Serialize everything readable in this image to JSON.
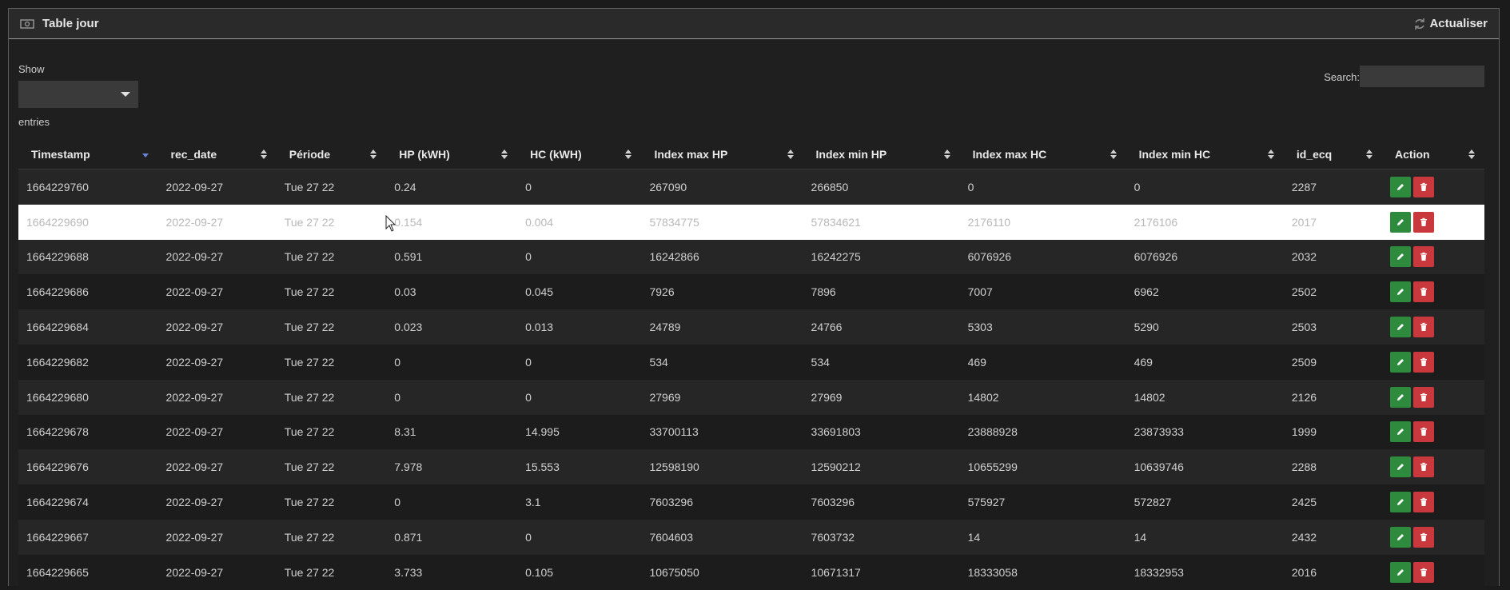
{
  "panel": {
    "title": "Table jour",
    "refresh_label": "Actualiser"
  },
  "controls": {
    "show_label": "Show",
    "entries_label": "entries",
    "search_label": "Search:",
    "search_value": ""
  },
  "columns": [
    "Timestamp",
    "rec_date",
    "Période",
    "HP (kWH)",
    "HC (kWH)",
    "Index max HP",
    "Index min HP",
    "Index max HC",
    "Index min HC",
    "id_ecq",
    "Action"
  ],
  "sorted_column": "Timestamp",
  "rows": [
    [
      "1664229760",
      "2022-09-27",
      "Tue 27 22",
      "0.24",
      "0",
      "267090",
      "266850",
      "0",
      "0",
      "2287"
    ],
    [
      "1664229690",
      "2022-09-27",
      "Tue 27 22",
      "0.154",
      "0.004",
      "57834775",
      "57834621",
      "2176110",
      "2176106",
      "2017"
    ],
    [
      "1664229688",
      "2022-09-27",
      "Tue 27 22",
      "0.591",
      "0",
      "16242866",
      "16242275",
      "6076926",
      "6076926",
      "2032"
    ],
    [
      "1664229686",
      "2022-09-27",
      "Tue 27 22",
      "0.03",
      "0.045",
      "7926",
      "7896",
      "7007",
      "6962",
      "2502"
    ],
    [
      "1664229684",
      "2022-09-27",
      "Tue 27 22",
      "0.023",
      "0.013",
      "24789",
      "24766",
      "5303",
      "5290",
      "2503"
    ],
    [
      "1664229682",
      "2022-09-27",
      "Tue 27 22",
      "0",
      "0",
      "534",
      "534",
      "469",
      "469",
      "2509"
    ],
    [
      "1664229680",
      "2022-09-27",
      "Tue 27 22",
      "0",
      "0",
      "27969",
      "27969",
      "14802",
      "14802",
      "2126"
    ],
    [
      "1664229678",
      "2022-09-27",
      "Tue 27 22",
      "8.31",
      "14.995",
      "33700113",
      "33691803",
      "23888928",
      "23873933",
      "1999"
    ],
    [
      "1664229676",
      "2022-09-27",
      "Tue 27 22",
      "7.978",
      "15.553",
      "12598190",
      "12590212",
      "10655299",
      "10639746",
      "2288"
    ],
    [
      "1664229674",
      "2022-09-27",
      "Tue 27 22",
      "0",
      "3.1",
      "7603296",
      "7603296",
      "575927",
      "572827",
      "2425"
    ],
    [
      "1664229667",
      "2022-09-27",
      "Tue 27 22",
      "0.871",
      "0",
      "7604603",
      "7603732",
      "14",
      "14",
      "2432"
    ],
    [
      "1664229665",
      "2022-09-27",
      "Tue 27 22",
      "3.733",
      "0.105",
      "10675050",
      "10671317",
      "18333058",
      "18332953",
      "2016"
    ]
  ],
  "highlighted_row": 1,
  "icons": {
    "header": "camera-icon",
    "refresh": "refresh-icon",
    "edit": "pencil-icon",
    "delete": "trash-icon"
  },
  "colors": {
    "edit": "#2e8b3e",
    "delete": "#c9383d",
    "sort_active": "#6b85d6"
  }
}
